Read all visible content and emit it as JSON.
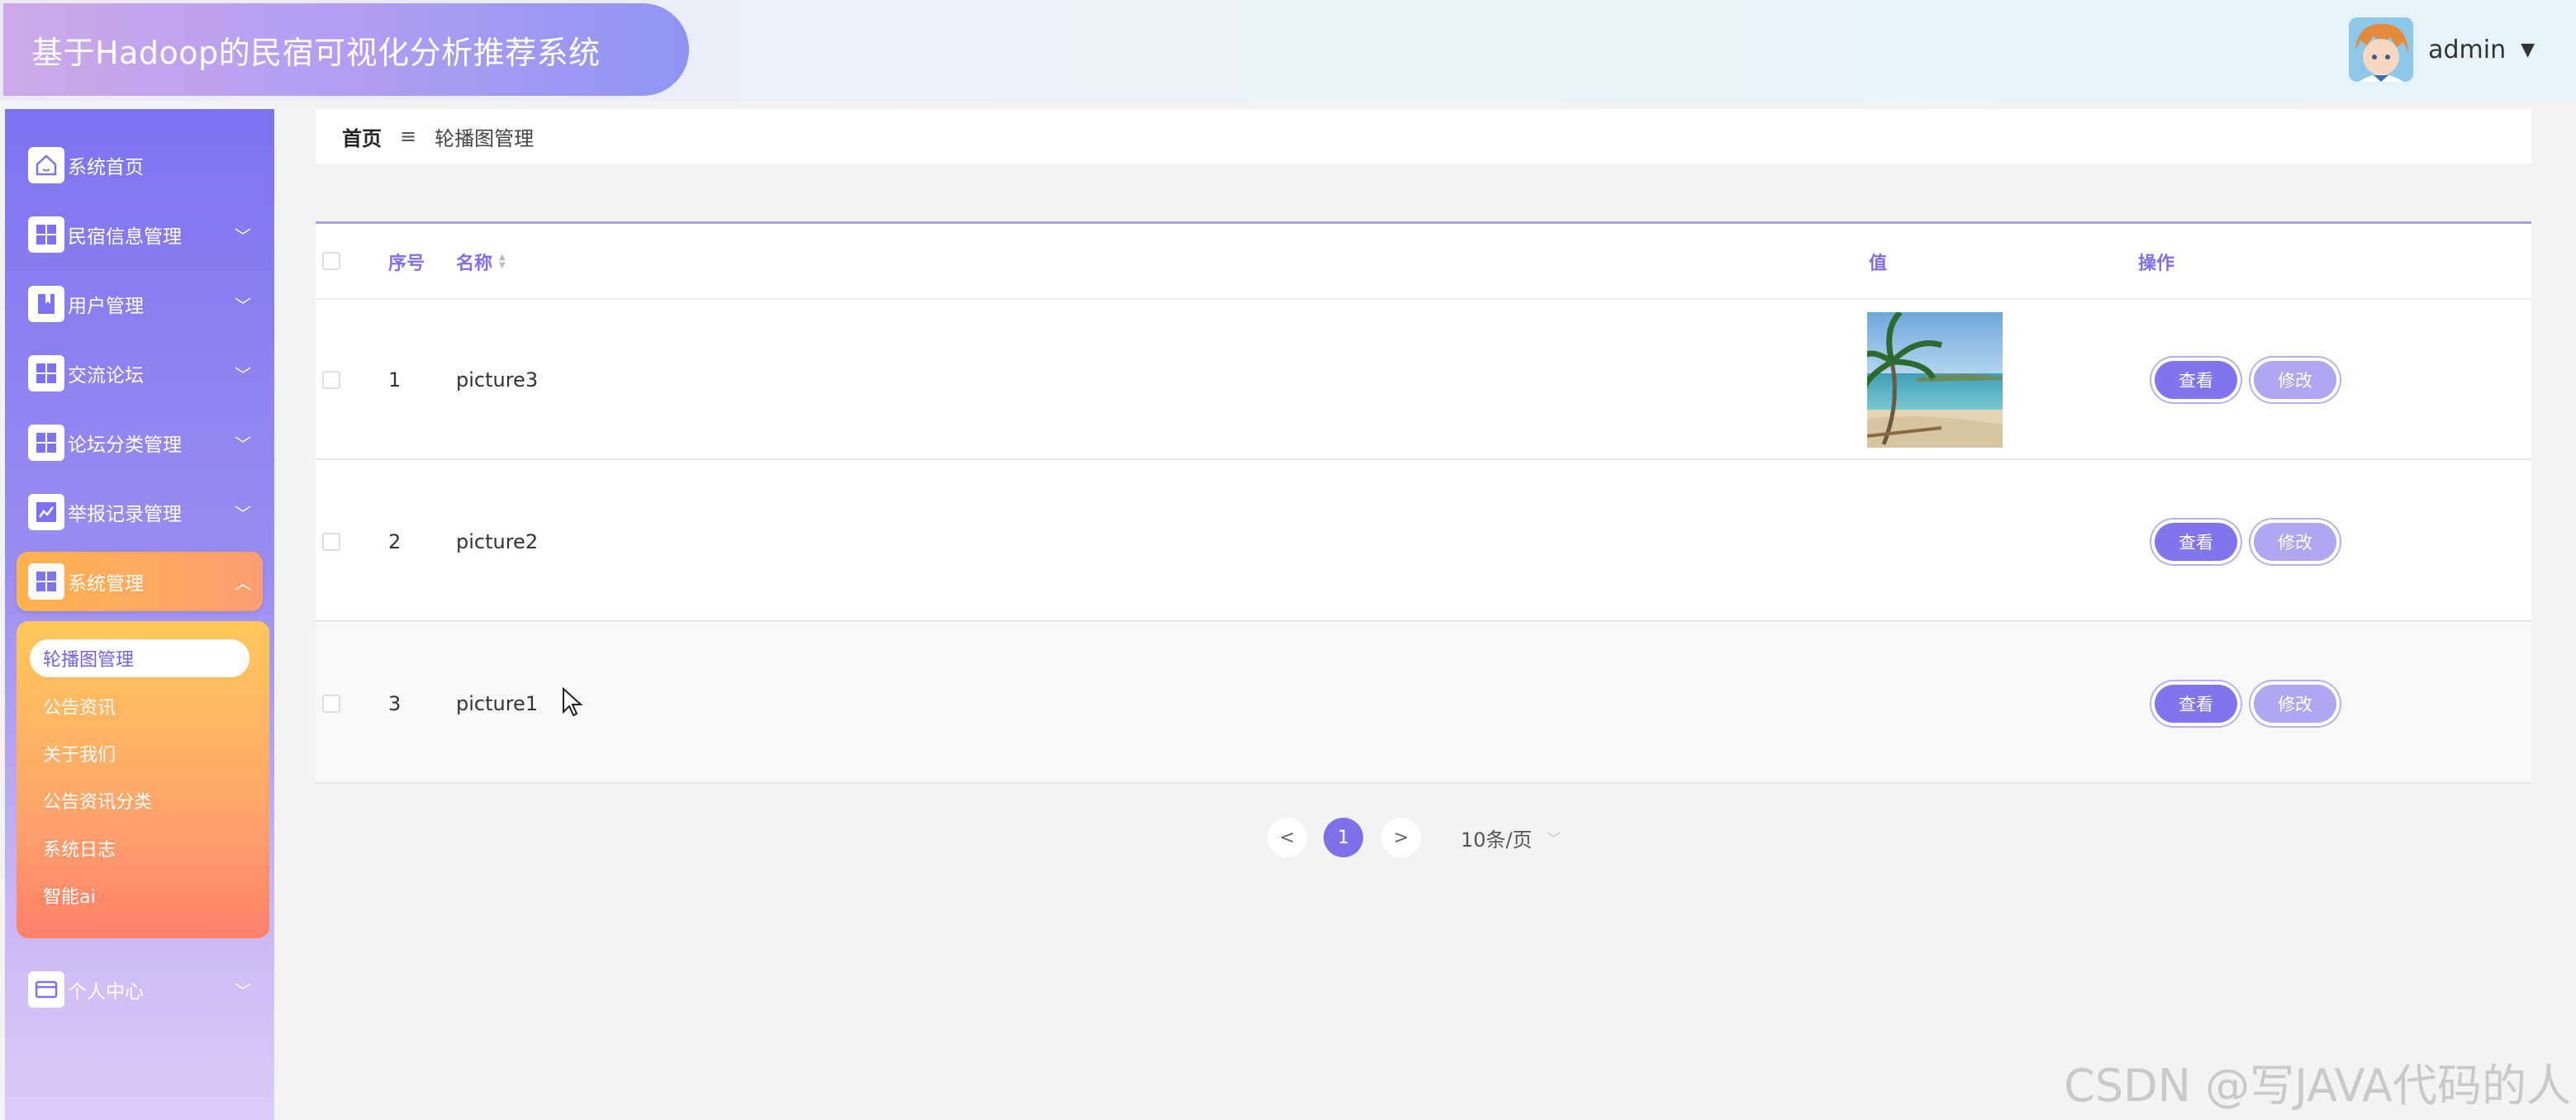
{
  "header": {
    "title": "基于Hadoop的民宿可视化分析推荐系统",
    "user_name": "admin"
  },
  "sidebar": {
    "items": [
      {
        "label": "系统首页",
        "icon": "home-icon"
      },
      {
        "label": "民宿信息管理",
        "icon": "grid-icon"
      },
      {
        "label": "用户管理",
        "icon": "bookmark-icon"
      },
      {
        "label": "交流论坛",
        "icon": "grid-icon"
      },
      {
        "label": "论坛分类管理",
        "icon": "grid-icon"
      },
      {
        "label": "举报记录管理",
        "icon": "chart-icon"
      },
      {
        "label": "系统管理",
        "icon": "grid-icon"
      },
      {
        "label": "个人中心",
        "icon": "card-icon"
      }
    ],
    "submenu": [
      "轮播图管理",
      "公告资讯",
      "关于我们",
      "公告资讯分类",
      "系统日志",
      "智能ai"
    ]
  },
  "breadcrumb": {
    "home": "首页",
    "separator": "≡",
    "current": "轮播图管理"
  },
  "table": {
    "headers": {
      "index": "序号",
      "name": "名称",
      "value": "值",
      "actions": "操作"
    },
    "rows": [
      {
        "index": "1",
        "name": "picture3",
        "has_image": true
      },
      {
        "index": "2",
        "name": "picture2",
        "has_image": false
      },
      {
        "index": "3",
        "name": "picture1",
        "has_image": false
      }
    ],
    "view_label": "查看",
    "edit_label": "修改"
  },
  "pagination": {
    "prev": "<",
    "next": ">",
    "current_page": "1",
    "page_size": "10条/页"
  },
  "watermark": "CSDN @写JAVA代码的人",
  "colors": {
    "accent": "#7d70e8",
    "active_menu": "#ffb34d",
    "sidebar_top": "#7d73f1"
  }
}
